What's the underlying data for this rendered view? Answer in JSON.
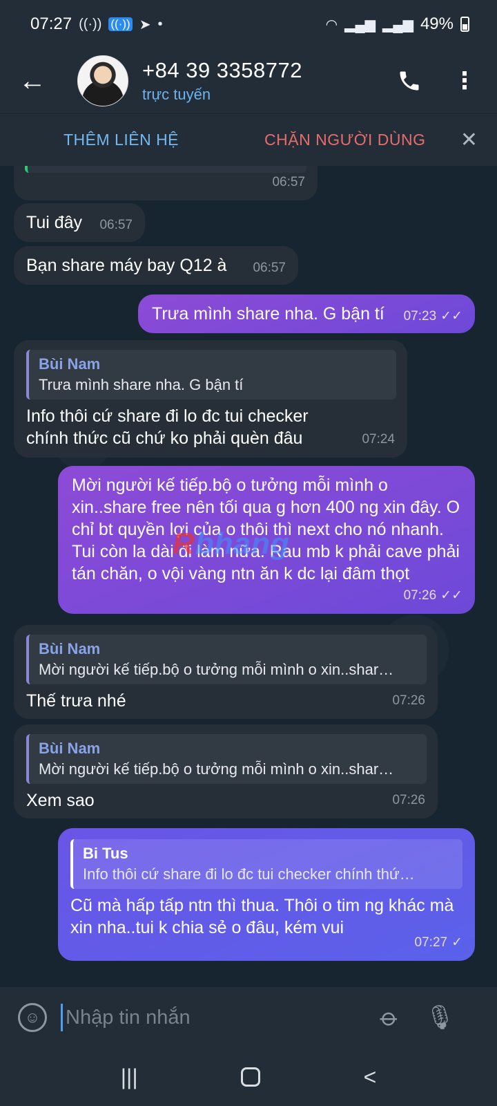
{
  "status_bar": {
    "time": "07:27",
    "battery": "49%",
    "icons": [
      "wifi-calling-icon",
      "hotspot-icon",
      "telegram-icon",
      "dot-icon",
      "wifi-icon",
      "signal-icon",
      "signal-icon",
      "battery-icon"
    ]
  },
  "header": {
    "name": "+84 39 3358772",
    "status": "trực tuyến"
  },
  "action_bar": {
    "add_contact": "THÊM LIÊN HỆ",
    "block_user": "CHẶN NGƯỜI DÙNG"
  },
  "messages": [
    {
      "dir": "in",
      "text": "",
      "time": "06:57"
    },
    {
      "dir": "in",
      "text": "Tui đây",
      "time": "06:57"
    },
    {
      "dir": "in",
      "text": "Bạn share máy bay Q12 à",
      "time": "06:57"
    },
    {
      "dir": "out",
      "text": "Trưa mình share nha. G bận tí",
      "time": "07:23"
    },
    {
      "dir": "in",
      "reply_name": "Bùi Nam",
      "reply_text": "Trưa mình share nha. G bận tí",
      "text": "Info  thôi cứ share đi lo đc tui checker chính thức cũ chứ ko phải quèn đâu",
      "time": "07:24"
    },
    {
      "dir": "out",
      "text": "Mời người kế tiếp.bộ o tưởng mỗi mình o xin..share free nên tối qua g hơn 400 ng xin đây. O chỉ bt quyền lợi của o thôi thì next cho nó nhanh. Tui còn la dài đi làm nữa. Rau mb k phải cave phải tán chăn, o vội vàng ntn ăn k dc lại đâm thọt",
      "time": "07:26"
    },
    {
      "dir": "in",
      "reply_name": "Bùi Nam",
      "reply_text": "Mời người kế tiếp.bộ o tưởng mỗi mình o xin..shar…",
      "text": "Thế trưa nhé",
      "time": "07:26"
    },
    {
      "dir": "in",
      "reply_name": "Bùi Nam",
      "reply_text": "Mời người kế tiếp.bộ o tưởng mỗi mình o xin..shar…",
      "text": "Xem sao",
      "time": "07:26"
    },
    {
      "dir": "out",
      "reply_name": "Bi Tus",
      "reply_text": "Info  thôi cứ share đi lo đc tui checker chính thứ…",
      "text": "Cũ mà hấp tấp ntn thì thua. Thôi o tim ng khác mà xin nha..tui k chia sẻ o đâu, kém vui",
      "time": "07:27"
    }
  ],
  "watermark": {
    "first": "R",
    "rest": "bhang"
  },
  "input": {
    "placeholder": "Nhập tin nhắn"
  },
  "nav": {
    "recents": "|||",
    "back": "<"
  },
  "colors": {
    "header_bg": "#222d37",
    "chat_bg": "#172530",
    "incoming_bubble": "#262f38",
    "outgoing_bubble": "#8d4bd6",
    "accent_blue": "#74b8f2",
    "danger_red": "#e86c6c"
  }
}
